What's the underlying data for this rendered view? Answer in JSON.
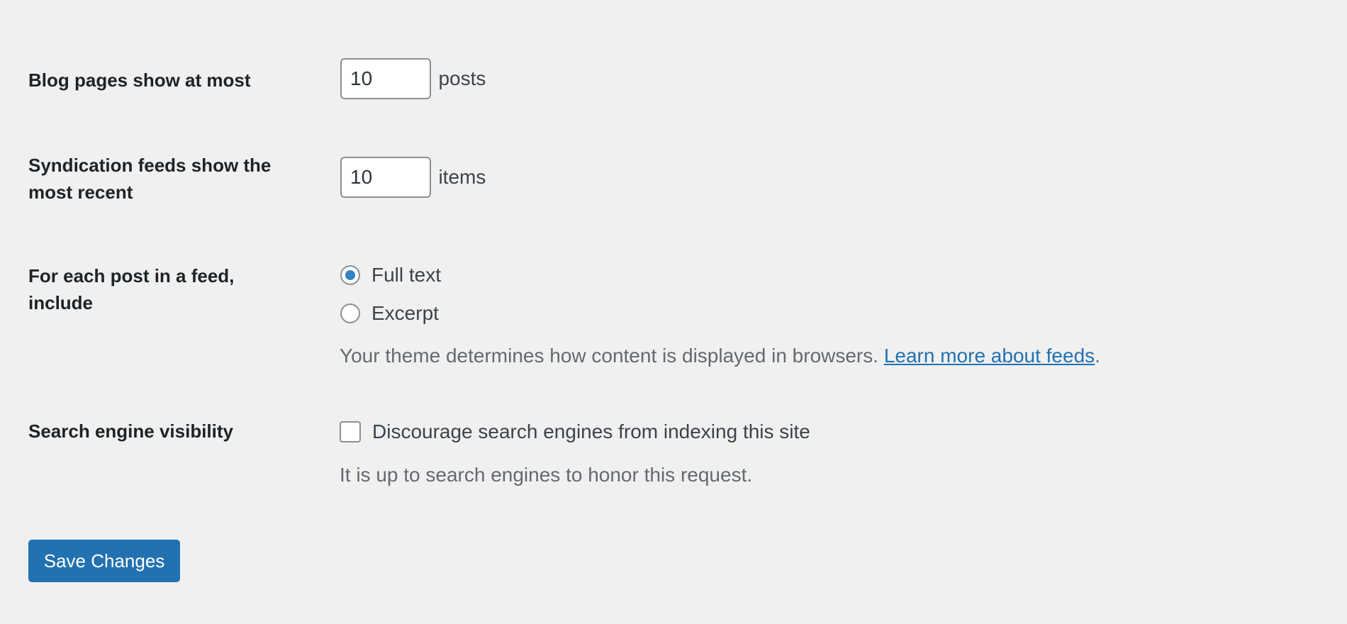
{
  "settings": {
    "blog_pages": {
      "label": "Blog pages show at most",
      "value": "10",
      "unit": "posts"
    },
    "syndication": {
      "label": "Syndication feeds show the most recent",
      "value": "10",
      "unit": "items"
    },
    "feed_content": {
      "label": "For each post in a feed, include",
      "options": [
        {
          "label": "Full text",
          "checked": true
        },
        {
          "label": "Excerpt",
          "checked": false
        }
      ],
      "description": "Your theme determines how content is displayed in browsers.",
      "link_text": "Learn more about feeds",
      "period": "."
    },
    "search_visibility": {
      "label": "Search engine visibility",
      "checkbox_label": "Discourage search engines from indexing this site",
      "checked": false,
      "description": "It is up to search engines to honor this request."
    }
  },
  "save_button": {
    "label": "Save Changes"
  },
  "colors": {
    "background": "#f0f0f1",
    "accent": "#2271b1",
    "radio_dot": "#3582c4"
  }
}
